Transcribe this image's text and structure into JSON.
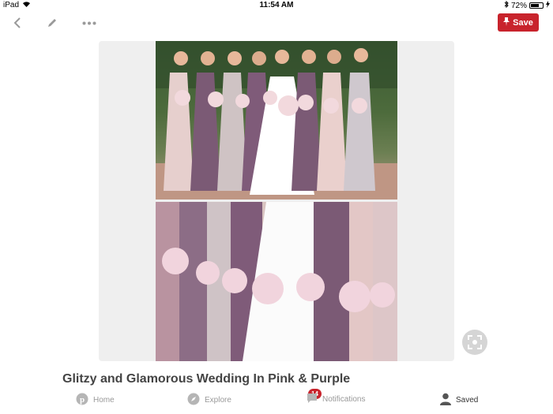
{
  "status_bar": {
    "device": "iPad",
    "time": "11:54 AM",
    "battery_percent": "72%",
    "battery_level": 0.72
  },
  "toolbar": {
    "save_label": "Save",
    "icons": [
      "chevron-left-icon",
      "pencil-icon",
      "more-dots-icon",
      "pin-icon"
    ]
  },
  "pin": {
    "title": "Glitzy and Glamorous Wedding In Pink & Purple"
  },
  "bottom_nav": {
    "items": [
      {
        "label": "Home",
        "icon": "pinterest-logo-icon"
      },
      {
        "label": "Explore",
        "icon": "compass-icon"
      },
      {
        "label": "Notifications",
        "icon": "speech-bubble-icon"
      },
      {
        "label": "Saved",
        "icon": "person-icon"
      }
    ],
    "notifications_badge": "14"
  },
  "colors": {
    "accent": "#c8232c",
    "frame_bg": "#efefef",
    "icon_gray": "#9a9a9a"
  }
}
